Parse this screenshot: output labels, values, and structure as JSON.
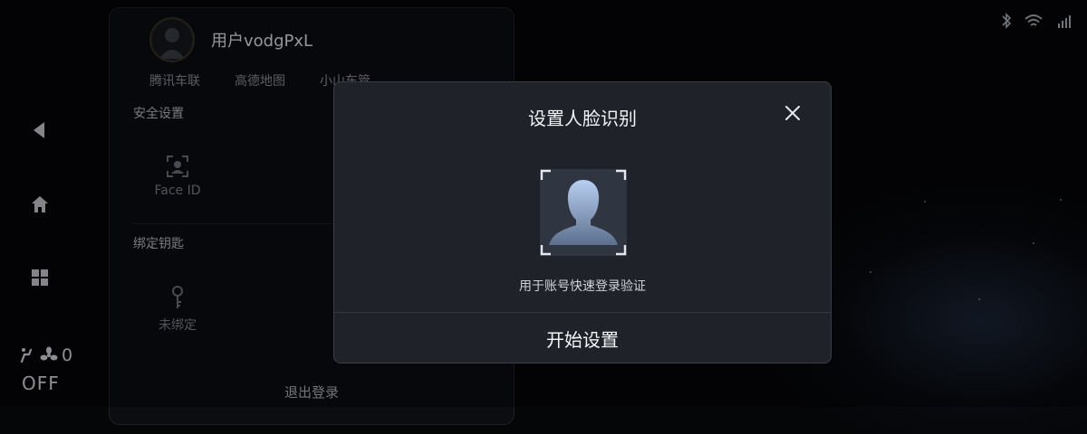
{
  "status_bar": {
    "icons": [
      "bluetooth-icon",
      "wifi-icon",
      "signal-4g-icon"
    ]
  },
  "left_rail": {
    "items": [
      "back-icon",
      "home-icon",
      "apps-grid-icon"
    ],
    "fan": {
      "value": "0"
    },
    "ac": {
      "label": "OFF"
    }
  },
  "account_panel": {
    "username": "用户vodgPxL",
    "tabs": [
      "腾讯车联",
      "高德地图",
      "小山车管"
    ],
    "security": {
      "title": "安全设置",
      "face_id_label": "Face ID"
    },
    "keys": {
      "title": "绑定钥匙",
      "status_label": "未绑定"
    },
    "logout_label": "退出登录"
  },
  "modal": {
    "title": "设置人脸识别",
    "description": "用于账号快速登录验证",
    "action_label": "开始设置"
  },
  "colors": {
    "background": "#050608",
    "modal_bg": "#1f2329",
    "face_silhouette": "#a9c2ea"
  }
}
